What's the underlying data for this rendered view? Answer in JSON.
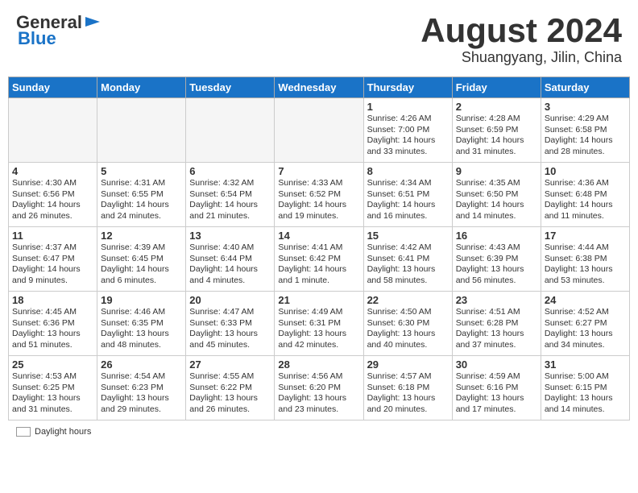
{
  "header": {
    "logo_general": "General",
    "logo_blue": "Blue",
    "title": "August 2024",
    "subtitle": "Shuangyang, Jilin, China"
  },
  "weekdays": [
    "Sunday",
    "Monday",
    "Tuesday",
    "Wednesday",
    "Thursday",
    "Friday",
    "Saturday"
  ],
  "weeks": [
    [
      {
        "day": "",
        "info": ""
      },
      {
        "day": "",
        "info": ""
      },
      {
        "day": "",
        "info": ""
      },
      {
        "day": "",
        "info": ""
      },
      {
        "day": "1",
        "info": "Sunrise: 4:26 AM\nSunset: 7:00 PM\nDaylight: 14 hours and 33 minutes."
      },
      {
        "day": "2",
        "info": "Sunrise: 4:28 AM\nSunset: 6:59 PM\nDaylight: 14 hours and 31 minutes."
      },
      {
        "day": "3",
        "info": "Sunrise: 4:29 AM\nSunset: 6:58 PM\nDaylight: 14 hours and 28 minutes."
      }
    ],
    [
      {
        "day": "4",
        "info": "Sunrise: 4:30 AM\nSunset: 6:56 PM\nDaylight: 14 hours and 26 minutes."
      },
      {
        "day": "5",
        "info": "Sunrise: 4:31 AM\nSunset: 6:55 PM\nDaylight: 14 hours and 24 minutes."
      },
      {
        "day": "6",
        "info": "Sunrise: 4:32 AM\nSunset: 6:54 PM\nDaylight: 14 hours and 21 minutes."
      },
      {
        "day": "7",
        "info": "Sunrise: 4:33 AM\nSunset: 6:52 PM\nDaylight: 14 hours and 19 minutes."
      },
      {
        "day": "8",
        "info": "Sunrise: 4:34 AM\nSunset: 6:51 PM\nDaylight: 14 hours and 16 minutes."
      },
      {
        "day": "9",
        "info": "Sunrise: 4:35 AM\nSunset: 6:50 PM\nDaylight: 14 hours and 14 minutes."
      },
      {
        "day": "10",
        "info": "Sunrise: 4:36 AM\nSunset: 6:48 PM\nDaylight: 14 hours and 11 minutes."
      }
    ],
    [
      {
        "day": "11",
        "info": "Sunrise: 4:37 AM\nSunset: 6:47 PM\nDaylight: 14 hours and 9 minutes."
      },
      {
        "day": "12",
        "info": "Sunrise: 4:39 AM\nSunset: 6:45 PM\nDaylight: 14 hours and 6 minutes."
      },
      {
        "day": "13",
        "info": "Sunrise: 4:40 AM\nSunset: 6:44 PM\nDaylight: 14 hours and 4 minutes."
      },
      {
        "day": "14",
        "info": "Sunrise: 4:41 AM\nSunset: 6:42 PM\nDaylight: 14 hours and 1 minute."
      },
      {
        "day": "15",
        "info": "Sunrise: 4:42 AM\nSunset: 6:41 PM\nDaylight: 13 hours and 58 minutes."
      },
      {
        "day": "16",
        "info": "Sunrise: 4:43 AM\nSunset: 6:39 PM\nDaylight: 13 hours and 56 minutes."
      },
      {
        "day": "17",
        "info": "Sunrise: 4:44 AM\nSunset: 6:38 PM\nDaylight: 13 hours and 53 minutes."
      }
    ],
    [
      {
        "day": "18",
        "info": "Sunrise: 4:45 AM\nSunset: 6:36 PM\nDaylight: 13 hours and 51 minutes."
      },
      {
        "day": "19",
        "info": "Sunrise: 4:46 AM\nSunset: 6:35 PM\nDaylight: 13 hours and 48 minutes."
      },
      {
        "day": "20",
        "info": "Sunrise: 4:47 AM\nSunset: 6:33 PM\nDaylight: 13 hours and 45 minutes."
      },
      {
        "day": "21",
        "info": "Sunrise: 4:49 AM\nSunset: 6:31 PM\nDaylight: 13 hours and 42 minutes."
      },
      {
        "day": "22",
        "info": "Sunrise: 4:50 AM\nSunset: 6:30 PM\nDaylight: 13 hours and 40 minutes."
      },
      {
        "day": "23",
        "info": "Sunrise: 4:51 AM\nSunset: 6:28 PM\nDaylight: 13 hours and 37 minutes."
      },
      {
        "day": "24",
        "info": "Sunrise: 4:52 AM\nSunset: 6:27 PM\nDaylight: 13 hours and 34 minutes."
      }
    ],
    [
      {
        "day": "25",
        "info": "Sunrise: 4:53 AM\nSunset: 6:25 PM\nDaylight: 13 hours and 31 minutes."
      },
      {
        "day": "26",
        "info": "Sunrise: 4:54 AM\nSunset: 6:23 PM\nDaylight: 13 hours and 29 minutes."
      },
      {
        "day": "27",
        "info": "Sunrise: 4:55 AM\nSunset: 6:22 PM\nDaylight: 13 hours and 26 minutes."
      },
      {
        "day": "28",
        "info": "Sunrise: 4:56 AM\nSunset: 6:20 PM\nDaylight: 13 hours and 23 minutes."
      },
      {
        "day": "29",
        "info": "Sunrise: 4:57 AM\nSunset: 6:18 PM\nDaylight: 13 hours and 20 minutes."
      },
      {
        "day": "30",
        "info": "Sunrise: 4:59 AM\nSunset: 6:16 PM\nDaylight: 13 hours and 17 minutes."
      },
      {
        "day": "31",
        "info": "Sunrise: 5:00 AM\nSunset: 6:15 PM\nDaylight: 13 hours and 14 minutes."
      }
    ]
  ],
  "footer": {
    "label": "Daylight hours"
  }
}
